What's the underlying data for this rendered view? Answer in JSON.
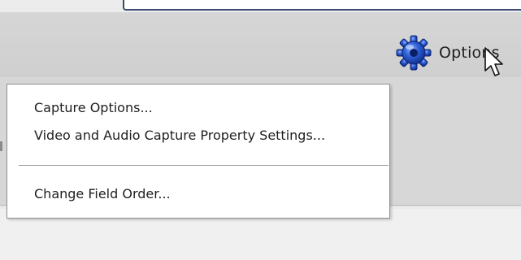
{
  "toolbar": {
    "options_label": "Options",
    "options_icon": "gear-icon"
  },
  "menu": {
    "items": [
      {
        "label": "Capture Options..."
      },
      {
        "label": "Video and Audio Capture Property Settings..."
      },
      {
        "label": "Change Field Order..."
      }
    ]
  },
  "colors": {
    "icon_blue": "#2451c8",
    "frame_border": "#3b4a73",
    "menu_border": "#8f8f8f"
  }
}
